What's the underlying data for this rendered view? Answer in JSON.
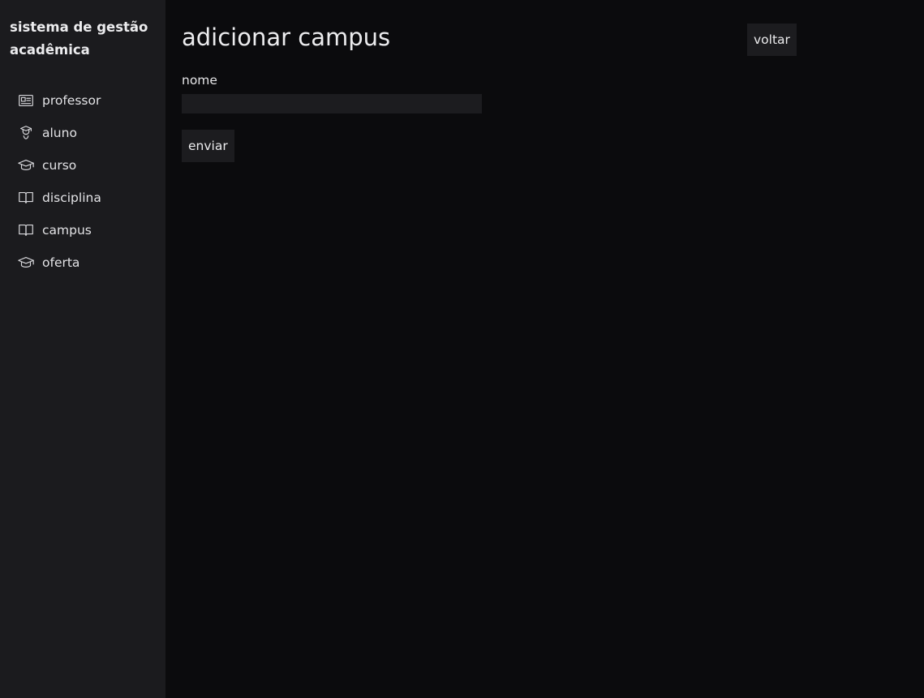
{
  "sidebar": {
    "brand": "sistema de gestão acadêmica",
    "items": [
      {
        "label": "professor",
        "icon": "id-card-icon"
      },
      {
        "label": "aluno",
        "icon": "student-icon"
      },
      {
        "label": "curso",
        "icon": "graduation-cap-icon"
      },
      {
        "label": "disciplina",
        "icon": "book-icon"
      },
      {
        "label": "campus",
        "icon": "book-icon"
      },
      {
        "label": "oferta",
        "icon": "graduation-cap-icon"
      }
    ]
  },
  "main": {
    "title": "adicionar campus",
    "back_label": "voltar",
    "form": {
      "name_label": "nome",
      "name_value": "",
      "submit_label": "enviar"
    }
  },
  "colors": {
    "background": "#0b0b0d",
    "sidebar": "#1b1b1e",
    "control": "#1c1c1f",
    "text": "#e6e6e8"
  }
}
